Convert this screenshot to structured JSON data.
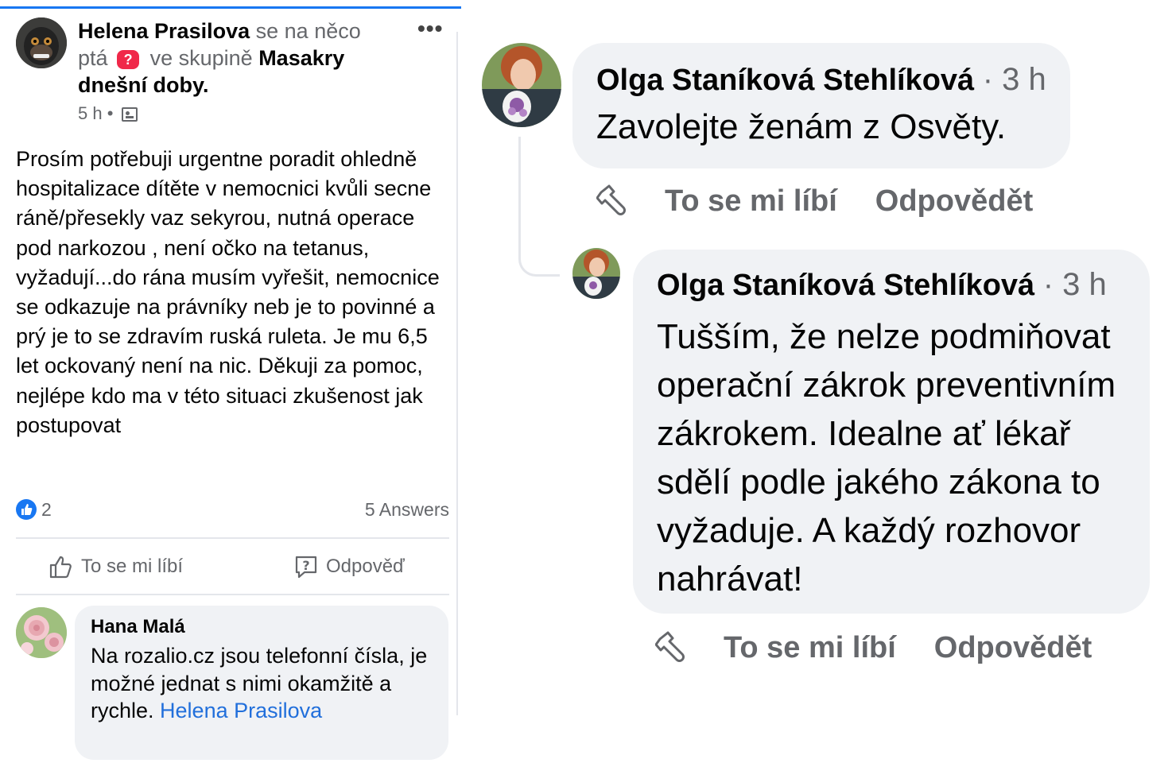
{
  "post": {
    "author": "Helena Prasilova",
    "verb_1": "se na něco",
    "verb_2": "ptá",
    "in_group": "ve skupině",
    "group_name": "Masakry",
    "group_name_2": "dnešní doby.",
    "time": "5 h",
    "body": "Prosím potřebuji urgentne poradit ohledně hospitalizace dítěte v nemocnici kvůli secne ráně/přesekly vaz sekyrou, nutná operace pod narkozou , není očko na tetanus, vyžadují...do rána musím vyřešit, nemocnice se odkazuje na právníky neb je to povinné a prý je to se zdravím ruská ruleta. Je mu 6,5 let ockovaný není na nic. Děkuji za pomoc, nejlépe kdo ma v této situaci zkušenost jak postupovat",
    "likes": "2",
    "answers": "5 Answers",
    "actions": {
      "like": "To se mi líbí",
      "reply": "Odpověď"
    }
  },
  "comment_left": {
    "author": "Hana Malá",
    "text": "Na rozalio.cz jsou telefonní čísla, je možné jednat s nimi okamžitě a rychle.",
    "mention": "Helena Prasilova"
  },
  "comments_right": [
    {
      "author": "Olga Staníková Stehlíková",
      "time": "· 3 h",
      "text": "Zavolejte ženám z Osvěty.",
      "actions": {
        "like": "To se mi líbí",
        "reply": "Odpovědět"
      }
    },
    {
      "author": "Olga Staníková Stehlíková",
      "time": "· 3 h",
      "text": "Tušším, že nelze podmiňovat operační zákrok preventivním zákrokem. Idealne ať lékař sdělí podle jakého zákona to vyžaduje. A každý rozhovor nahrávat!",
      "actions": {
        "like": "To se mi líbí",
        "reply": "Odpovědět"
      }
    }
  ],
  "colors": {
    "accent": "#1877f2",
    "mention": "#216fdb",
    "question_badge": "#f02849",
    "bubble": "#f0f2f5",
    "secondary_text": "#65676b"
  },
  "icons": {
    "more": "more-icon",
    "question_badge": "question-badge-icon",
    "group": "group-icon",
    "like": "thumbs-up-icon",
    "reply": "question-bubble-icon",
    "comment_reaction": "thumbs-up-outline-icon"
  }
}
